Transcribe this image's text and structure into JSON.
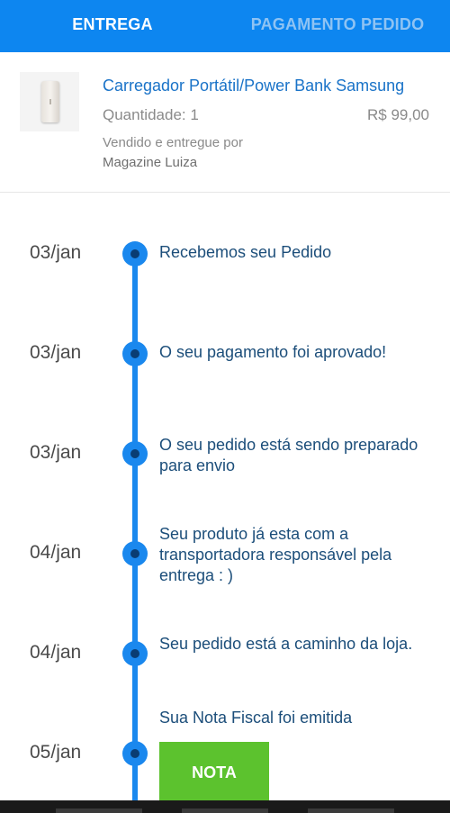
{
  "tabs": {
    "active": "ENTREGA",
    "inactive": "PAGAMENTO PEDIDO"
  },
  "colors": {
    "primary": "#0d86f0",
    "timeline": "#1a88ee",
    "button": "#5cc22e",
    "link": "#1a73c8"
  },
  "product": {
    "image_icon": "power-bank-image",
    "name": "Carregador Portátil/Power Bank Samsung",
    "quantity": "Quantidade: 1",
    "price": "R$ 99,00",
    "seller_label": "Vendido e entregue por",
    "seller": "Magazine Luiza"
  },
  "timeline": [
    {
      "date": "03/jan",
      "text": "Recebemos seu Pedido"
    },
    {
      "date": "03/jan",
      "text": "O seu pagamento foi aprovado!"
    },
    {
      "date": "03/jan",
      "text": "O seu pedido está sendo preparado para envio"
    },
    {
      "date": "04/jan",
      "text": "Seu produto já esta com a transportadora responsável pela entrega : )"
    },
    {
      "date": "04/jan",
      "text": "Seu pedido está a caminho da loja."
    },
    {
      "date": "05/jan",
      "text": "Sua Nota Fiscal foi emitida"
    }
  ],
  "nota_button": "NOTA"
}
